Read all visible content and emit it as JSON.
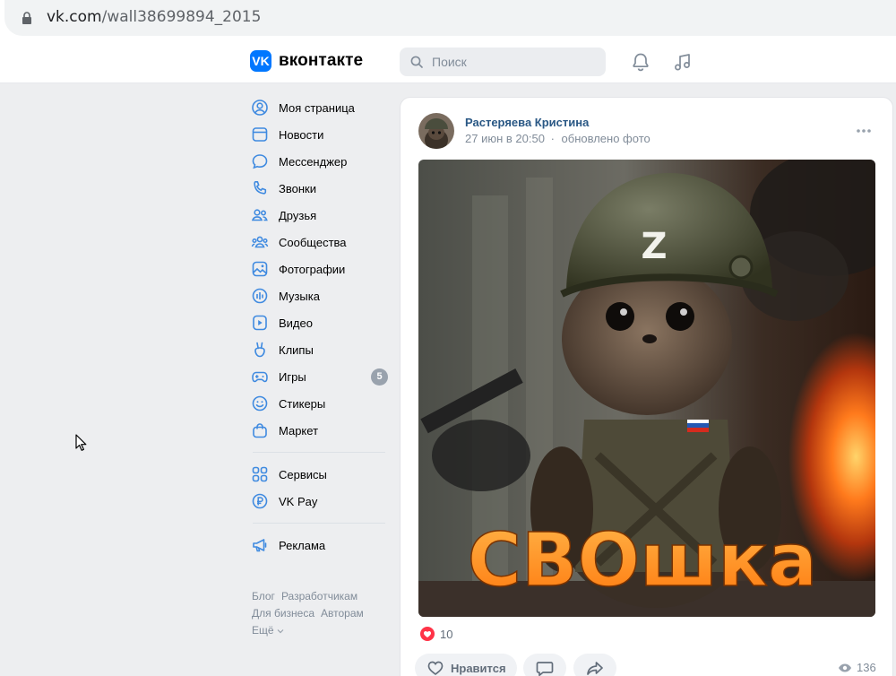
{
  "browser": {
    "url_host": "vk.com",
    "url_path": "/wall38699894_2015"
  },
  "header": {
    "logo_text": "вконтакте",
    "logo_mark": "VK",
    "search_placeholder": "Поиск",
    "icons": [
      "bell-icon",
      "music-note-icon"
    ]
  },
  "nav": {
    "items": [
      {
        "label": "Моя страница",
        "icon": "user-circle-icon"
      },
      {
        "label": "Новости",
        "icon": "news-icon"
      },
      {
        "label": "Мессенджер",
        "icon": "message-icon"
      },
      {
        "label": "Звонки",
        "icon": "phone-icon"
      },
      {
        "label": "Друзья",
        "icon": "friends-icon"
      },
      {
        "label": "Сообщества",
        "icon": "communities-icon"
      },
      {
        "label": "Фотографии",
        "icon": "photo-icon"
      },
      {
        "label": "Музыка",
        "icon": "music-icon"
      },
      {
        "label": "Видео",
        "icon": "video-icon"
      },
      {
        "label": "Клипы",
        "icon": "clips-icon"
      },
      {
        "label": "Игры",
        "icon": "gamepad-icon",
        "badge": "5"
      },
      {
        "label": "Стикеры",
        "icon": "sticker-icon"
      },
      {
        "label": "Маркет",
        "icon": "market-bag-icon"
      }
    ],
    "secondary": [
      {
        "label": "Сервисы",
        "icon": "services-icon"
      },
      {
        "label": "VK Pay",
        "icon": "vkpay-icon"
      }
    ],
    "tertiary": [
      {
        "label": "Реклама",
        "icon": "megaphone-icon"
      }
    ],
    "footer": {
      "blog": "Блог",
      "developers": "Разработчикам",
      "business": "Для бизнеса",
      "authors": "Авторам",
      "more": "Ещё"
    }
  },
  "post": {
    "author": "Растеряева Кристина",
    "date": "27 июн в 20:50",
    "separator": "·",
    "action": "обновлено фото",
    "photo_caption": "СВОшка",
    "helmet_letter": "Z",
    "likes_count": "10",
    "like_label": "Нравится",
    "views_count": "136"
  },
  "colors": {
    "accent": "#0077ff",
    "link": "#2a5885",
    "secondary_text": "#818c99",
    "like_red": "#ff3347",
    "caption_orange": "#ff8a1f"
  }
}
